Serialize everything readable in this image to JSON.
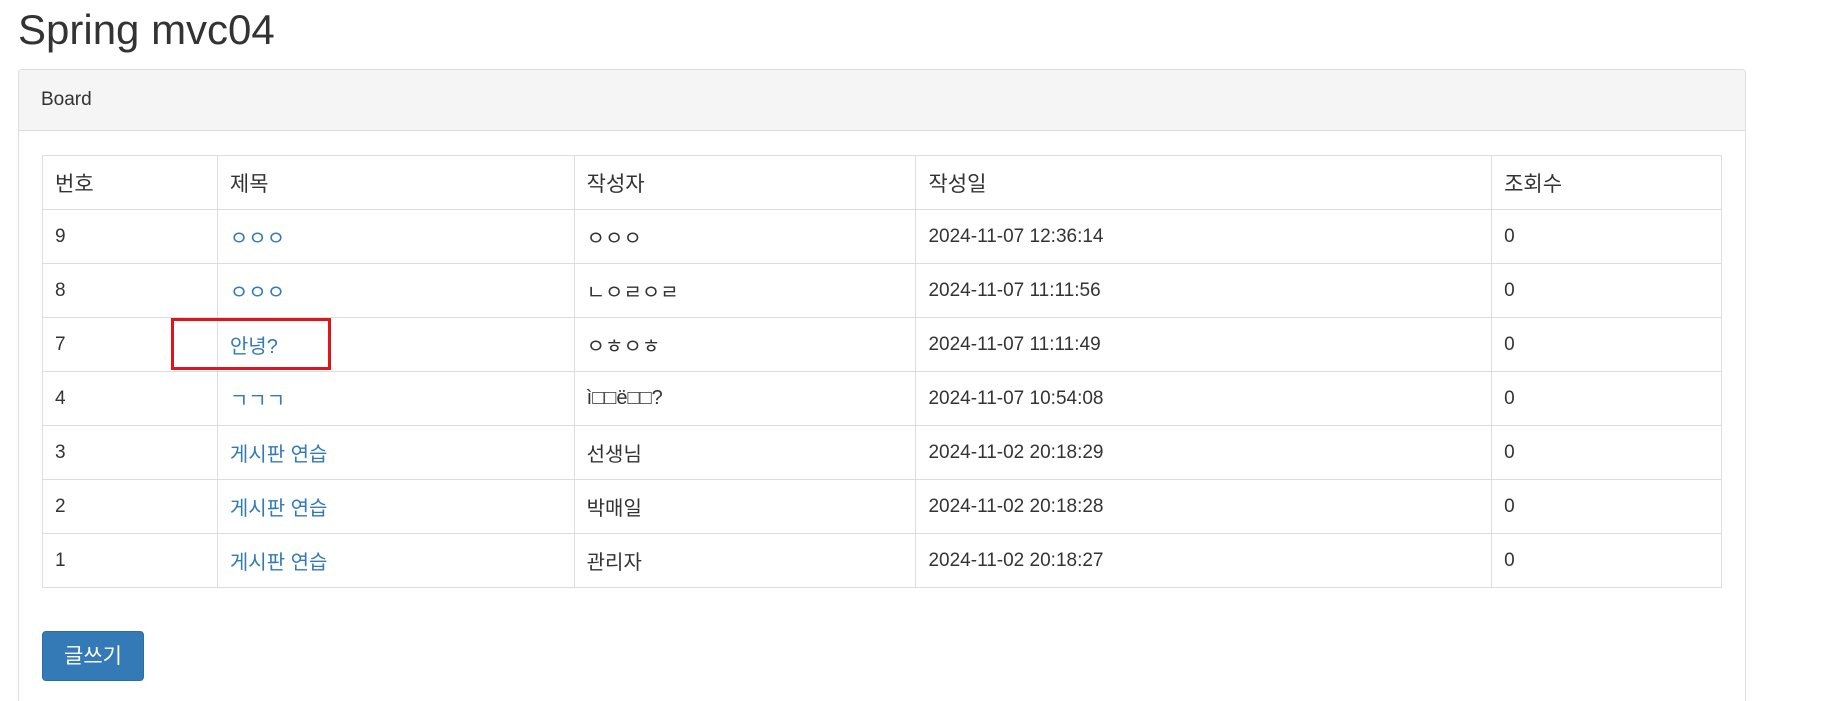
{
  "page": {
    "title": "Spring mvc04"
  },
  "panel": {
    "heading": "Board"
  },
  "table": {
    "headers": [
      "번호",
      "제목",
      "작성자",
      "작성일",
      "조회수"
    ],
    "rows": [
      {
        "no": "9",
        "title": "ㅇㅇㅇ",
        "writer": "ㅇㅇㅇ",
        "date": "2024-11-07 12:36:14",
        "count": "0"
      },
      {
        "no": "8",
        "title": "ㅇㅇㅇ",
        "writer": "ㄴㅇㄹㅇㄹ",
        "date": "2024-11-07 11:11:56",
        "count": "0"
      },
      {
        "no": "7",
        "title": "안녕?",
        "writer": "ㅇㅎㅇㅎ",
        "date": "2024-11-07 11:11:49",
        "count": "0"
      },
      {
        "no": "4",
        "title": "ㄱㄱㄱ",
        "writer": "ì□□ë□□?",
        "date": "2024-11-07 10:54:08",
        "count": "0"
      },
      {
        "no": "3",
        "title": "게시판 연습",
        "writer": "선생님",
        "date": "2024-11-02 20:18:29",
        "count": "0"
      },
      {
        "no": "2",
        "title": "게시판 연습",
        "writer": "박매일",
        "date": "2024-11-02 20:18:28",
        "count": "0"
      },
      {
        "no": "1",
        "title": "게시판 연습",
        "writer": "관리자",
        "date": "2024-11-02 20:18:27",
        "count": "0"
      }
    ]
  },
  "actions": {
    "write_label": "글쓰기"
  },
  "colors": {
    "link": "#337ab7",
    "primary_button": "#337ab7",
    "highlight": "#e0151c",
    "panel_heading_bg": "#f5f5f5",
    "border": "#dddddd"
  }
}
